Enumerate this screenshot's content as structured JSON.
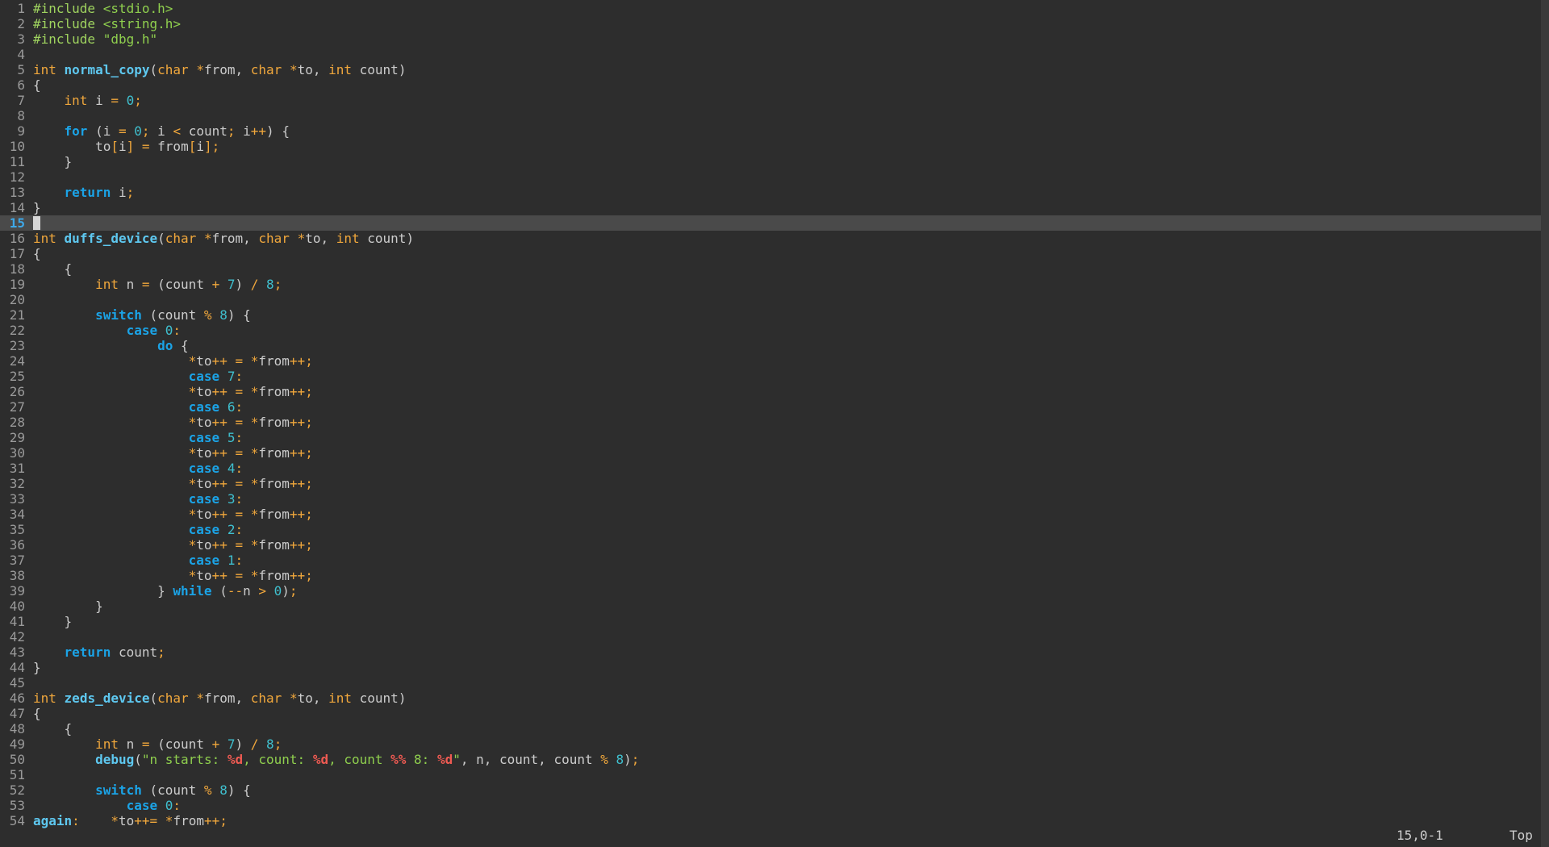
{
  "editor": {
    "cursor_line": 15,
    "lines": [
      [
        [
          "pp",
          "#include"
        ],
        [
          "id",
          " "
        ],
        [
          "str",
          "<stdio.h>"
        ]
      ],
      [
        [
          "pp",
          "#include"
        ],
        [
          "id",
          " "
        ],
        [
          "str",
          "<string.h>"
        ]
      ],
      [
        [
          "pp",
          "#include"
        ],
        [
          "id",
          " "
        ],
        [
          "str",
          "\"dbg.h\""
        ]
      ],
      [],
      [
        [
          "ty",
          "int"
        ],
        [
          "id",
          " "
        ],
        [
          "fn",
          "normal_copy"
        ],
        [
          "id",
          "("
        ],
        [
          "ty",
          "char"
        ],
        [
          "id",
          " "
        ],
        [
          "op",
          "*"
        ],
        [
          "id",
          "from, "
        ],
        [
          "ty",
          "char"
        ],
        [
          "id",
          " "
        ],
        [
          "op",
          "*"
        ],
        [
          "id",
          "to, "
        ],
        [
          "ty",
          "int"
        ],
        [
          "id",
          " count)"
        ]
      ],
      [
        [
          "id",
          "{"
        ]
      ],
      [
        [
          "id",
          "    "
        ],
        [
          "ty",
          "int"
        ],
        [
          "id",
          " i "
        ],
        [
          "op",
          "="
        ],
        [
          "id",
          " "
        ],
        [
          "num",
          "0"
        ],
        [
          "op",
          ";"
        ]
      ],
      [],
      [
        [
          "id",
          "    "
        ],
        [
          "kw",
          "for"
        ],
        [
          "id",
          " (i "
        ],
        [
          "op",
          "="
        ],
        [
          "id",
          " "
        ],
        [
          "num",
          "0"
        ],
        [
          "op",
          ";"
        ],
        [
          "id",
          " i "
        ],
        [
          "op",
          "<"
        ],
        [
          "id",
          " count"
        ],
        [
          "op",
          ";"
        ],
        [
          "id",
          " i"
        ],
        [
          "op",
          "++"
        ],
        [
          "id",
          ") {"
        ]
      ],
      [
        [
          "id",
          "        to"
        ],
        [
          "op",
          "["
        ],
        [
          "id",
          "i"
        ],
        [
          "op",
          "]"
        ],
        [
          "id",
          " "
        ],
        [
          "op",
          "="
        ],
        [
          "id",
          " from"
        ],
        [
          "op",
          "["
        ],
        [
          "id",
          "i"
        ],
        [
          "op",
          "]"
        ],
        [
          "op",
          ";"
        ]
      ],
      [
        [
          "id",
          "    }"
        ]
      ],
      [],
      [
        [
          "id",
          "    "
        ],
        [
          "kw",
          "return"
        ],
        [
          "id",
          " i"
        ],
        [
          "op",
          ";"
        ]
      ],
      [
        [
          "id",
          "}"
        ]
      ],
      [],
      [
        [
          "ty",
          "int"
        ],
        [
          "id",
          " "
        ],
        [
          "fn",
          "duffs_device"
        ],
        [
          "id",
          "("
        ],
        [
          "ty",
          "char"
        ],
        [
          "id",
          " "
        ],
        [
          "op",
          "*"
        ],
        [
          "id",
          "from, "
        ],
        [
          "ty",
          "char"
        ],
        [
          "id",
          " "
        ],
        [
          "op",
          "*"
        ],
        [
          "id",
          "to, "
        ],
        [
          "ty",
          "int"
        ],
        [
          "id",
          " count)"
        ]
      ],
      [
        [
          "id",
          "{"
        ]
      ],
      [
        [
          "id",
          "    {"
        ]
      ],
      [
        [
          "id",
          "        "
        ],
        [
          "ty",
          "int"
        ],
        [
          "id",
          " n "
        ],
        [
          "op",
          "="
        ],
        [
          "id",
          " (count "
        ],
        [
          "op",
          "+"
        ],
        [
          "id",
          " "
        ],
        [
          "num",
          "7"
        ],
        [
          "id",
          ") "
        ],
        [
          "op",
          "/"
        ],
        [
          "id",
          " "
        ],
        [
          "num",
          "8"
        ],
        [
          "op",
          ";"
        ]
      ],
      [],
      [
        [
          "id",
          "        "
        ],
        [
          "kw",
          "switch"
        ],
        [
          "id",
          " (count "
        ],
        [
          "op",
          "%"
        ],
        [
          "id",
          " "
        ],
        [
          "num",
          "8"
        ],
        [
          "id",
          ") {"
        ]
      ],
      [
        [
          "id",
          "            "
        ],
        [
          "kw",
          "case"
        ],
        [
          "id",
          " "
        ],
        [
          "num",
          "0"
        ],
        [
          "op",
          ":"
        ]
      ],
      [
        [
          "id",
          "                "
        ],
        [
          "kw",
          "do"
        ],
        [
          "id",
          " {"
        ]
      ],
      [
        [
          "id",
          "                    "
        ],
        [
          "op",
          "*"
        ],
        [
          "id",
          "to"
        ],
        [
          "op",
          "++"
        ],
        [
          "id",
          " "
        ],
        [
          "op",
          "="
        ],
        [
          "id",
          " "
        ],
        [
          "op",
          "*"
        ],
        [
          "id",
          "from"
        ],
        [
          "op",
          "++"
        ],
        [
          "op",
          ";"
        ]
      ],
      [
        [
          "id",
          "                    "
        ],
        [
          "kw",
          "case"
        ],
        [
          "id",
          " "
        ],
        [
          "num",
          "7"
        ],
        [
          "op",
          ":"
        ]
      ],
      [
        [
          "id",
          "                    "
        ],
        [
          "op",
          "*"
        ],
        [
          "id",
          "to"
        ],
        [
          "op",
          "++"
        ],
        [
          "id",
          " "
        ],
        [
          "op",
          "="
        ],
        [
          "id",
          " "
        ],
        [
          "op",
          "*"
        ],
        [
          "id",
          "from"
        ],
        [
          "op",
          "++"
        ],
        [
          "op",
          ";"
        ]
      ],
      [
        [
          "id",
          "                    "
        ],
        [
          "kw",
          "case"
        ],
        [
          "id",
          " "
        ],
        [
          "num",
          "6"
        ],
        [
          "op",
          ":"
        ]
      ],
      [
        [
          "id",
          "                    "
        ],
        [
          "op",
          "*"
        ],
        [
          "id",
          "to"
        ],
        [
          "op",
          "++"
        ],
        [
          "id",
          " "
        ],
        [
          "op",
          "="
        ],
        [
          "id",
          " "
        ],
        [
          "op",
          "*"
        ],
        [
          "id",
          "from"
        ],
        [
          "op",
          "++"
        ],
        [
          "op",
          ";"
        ]
      ],
      [
        [
          "id",
          "                    "
        ],
        [
          "kw",
          "case"
        ],
        [
          "id",
          " "
        ],
        [
          "num",
          "5"
        ],
        [
          "op",
          ":"
        ]
      ],
      [
        [
          "id",
          "                    "
        ],
        [
          "op",
          "*"
        ],
        [
          "id",
          "to"
        ],
        [
          "op",
          "++"
        ],
        [
          "id",
          " "
        ],
        [
          "op",
          "="
        ],
        [
          "id",
          " "
        ],
        [
          "op",
          "*"
        ],
        [
          "id",
          "from"
        ],
        [
          "op",
          "++"
        ],
        [
          "op",
          ";"
        ]
      ],
      [
        [
          "id",
          "                    "
        ],
        [
          "kw",
          "case"
        ],
        [
          "id",
          " "
        ],
        [
          "num",
          "4"
        ],
        [
          "op",
          ":"
        ]
      ],
      [
        [
          "id",
          "                    "
        ],
        [
          "op",
          "*"
        ],
        [
          "id",
          "to"
        ],
        [
          "op",
          "++"
        ],
        [
          "id",
          " "
        ],
        [
          "op",
          "="
        ],
        [
          "id",
          " "
        ],
        [
          "op",
          "*"
        ],
        [
          "id",
          "from"
        ],
        [
          "op",
          "++"
        ],
        [
          "op",
          ";"
        ]
      ],
      [
        [
          "id",
          "                    "
        ],
        [
          "kw",
          "case"
        ],
        [
          "id",
          " "
        ],
        [
          "num",
          "3"
        ],
        [
          "op",
          ":"
        ]
      ],
      [
        [
          "id",
          "                    "
        ],
        [
          "op",
          "*"
        ],
        [
          "id",
          "to"
        ],
        [
          "op",
          "++"
        ],
        [
          "id",
          " "
        ],
        [
          "op",
          "="
        ],
        [
          "id",
          " "
        ],
        [
          "op",
          "*"
        ],
        [
          "id",
          "from"
        ],
        [
          "op",
          "++"
        ],
        [
          "op",
          ";"
        ]
      ],
      [
        [
          "id",
          "                    "
        ],
        [
          "kw",
          "case"
        ],
        [
          "id",
          " "
        ],
        [
          "num",
          "2"
        ],
        [
          "op",
          ":"
        ]
      ],
      [
        [
          "id",
          "                    "
        ],
        [
          "op",
          "*"
        ],
        [
          "id",
          "to"
        ],
        [
          "op",
          "++"
        ],
        [
          "id",
          " "
        ],
        [
          "op",
          "="
        ],
        [
          "id",
          " "
        ],
        [
          "op",
          "*"
        ],
        [
          "id",
          "from"
        ],
        [
          "op",
          "++"
        ],
        [
          "op",
          ";"
        ]
      ],
      [
        [
          "id",
          "                    "
        ],
        [
          "kw",
          "case"
        ],
        [
          "id",
          " "
        ],
        [
          "num",
          "1"
        ],
        [
          "op",
          ":"
        ]
      ],
      [
        [
          "id",
          "                    "
        ],
        [
          "op",
          "*"
        ],
        [
          "id",
          "to"
        ],
        [
          "op",
          "++"
        ],
        [
          "id",
          " "
        ],
        [
          "op",
          "="
        ],
        [
          "id",
          " "
        ],
        [
          "op",
          "*"
        ],
        [
          "id",
          "from"
        ],
        [
          "op",
          "++"
        ],
        [
          "op",
          ";"
        ]
      ],
      [
        [
          "id",
          "                } "
        ],
        [
          "kw",
          "while"
        ],
        [
          "id",
          " ("
        ],
        [
          "op",
          "--"
        ],
        [
          "id",
          "n "
        ],
        [
          "op",
          ">"
        ],
        [
          "id",
          " "
        ],
        [
          "num",
          "0"
        ],
        [
          "id",
          ")"
        ],
        [
          "op",
          ";"
        ]
      ],
      [
        [
          "id",
          "        }"
        ]
      ],
      [
        [
          "id",
          "    }"
        ]
      ],
      [],
      [
        [
          "id",
          "    "
        ],
        [
          "kw",
          "return"
        ],
        [
          "id",
          " count"
        ],
        [
          "op",
          ";"
        ]
      ],
      [
        [
          "id",
          "}"
        ]
      ],
      [],
      [
        [
          "ty",
          "int"
        ],
        [
          "id",
          " "
        ],
        [
          "fn",
          "zeds_device"
        ],
        [
          "id",
          "("
        ],
        [
          "ty",
          "char"
        ],
        [
          "id",
          " "
        ],
        [
          "op",
          "*"
        ],
        [
          "id",
          "from, "
        ],
        [
          "ty",
          "char"
        ],
        [
          "id",
          " "
        ],
        [
          "op",
          "*"
        ],
        [
          "id",
          "to, "
        ],
        [
          "ty",
          "int"
        ],
        [
          "id",
          " count)"
        ]
      ],
      [
        [
          "id",
          "{"
        ]
      ],
      [
        [
          "id",
          "    {"
        ]
      ],
      [
        [
          "id",
          "        "
        ],
        [
          "ty",
          "int"
        ],
        [
          "id",
          " n "
        ],
        [
          "op",
          "="
        ],
        [
          "id",
          " (count "
        ],
        [
          "op",
          "+"
        ],
        [
          "id",
          " "
        ],
        [
          "num",
          "7"
        ],
        [
          "id",
          ") "
        ],
        [
          "op",
          "/"
        ],
        [
          "id",
          " "
        ],
        [
          "num",
          "8"
        ],
        [
          "op",
          ";"
        ]
      ],
      [
        [
          "id",
          "        "
        ],
        [
          "fn",
          "debug"
        ],
        [
          "id",
          "("
        ],
        [
          "str",
          "\"n starts: "
        ],
        [
          "fmt",
          "%d"
        ],
        [
          "str",
          ", count: "
        ],
        [
          "fmt",
          "%d"
        ],
        [
          "str",
          ", count "
        ],
        [
          "fmt",
          "%%"
        ],
        [
          "str",
          " 8: "
        ],
        [
          "fmt",
          "%d"
        ],
        [
          "str",
          "\""
        ],
        [
          "id",
          ", n, count, count "
        ],
        [
          "op",
          "%"
        ],
        [
          "id",
          " "
        ],
        [
          "num",
          "8"
        ],
        [
          "id",
          ")"
        ],
        [
          "op",
          ";"
        ]
      ],
      [],
      [
        [
          "id",
          "        "
        ],
        [
          "kw",
          "switch"
        ],
        [
          "id",
          " (count "
        ],
        [
          "op",
          "%"
        ],
        [
          "id",
          " "
        ],
        [
          "num",
          "8"
        ],
        [
          "id",
          ") {"
        ]
      ],
      [
        [
          "id",
          "            "
        ],
        [
          "kw",
          "case"
        ],
        [
          "id",
          " "
        ],
        [
          "num",
          "0"
        ],
        [
          "op",
          ":"
        ]
      ],
      [
        [
          "lbl",
          "again"
        ],
        [
          "op",
          ":"
        ],
        [
          "id",
          "    "
        ],
        [
          "op",
          "*"
        ],
        [
          "id",
          "to"
        ],
        [
          "op",
          "++="
        ],
        [
          "id",
          " "
        ],
        [
          "op",
          "*"
        ],
        [
          "id",
          "from"
        ],
        [
          "op",
          "++"
        ],
        [
          "op",
          ";"
        ]
      ]
    ]
  },
  "status": {
    "position": "15,0-1",
    "scroll": "Top"
  },
  "colors": {
    "background": "#2d2d2d",
    "cursorline": "#4a4a4a",
    "keyword": "#1ba3e6",
    "type": "#f0a73c",
    "string": "#8fcf4e",
    "number": "#3fc0cf",
    "format": "#ee5a52"
  }
}
